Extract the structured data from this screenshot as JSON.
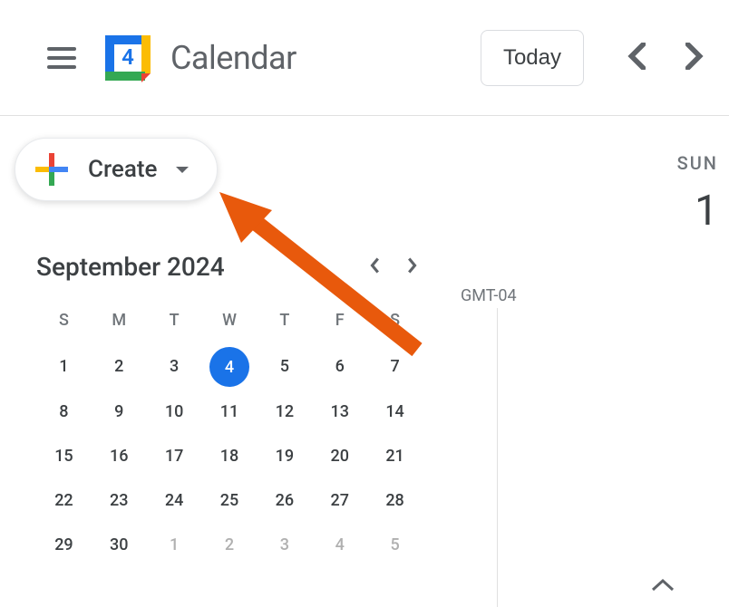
{
  "header": {
    "title": "Calendar",
    "today_label": "Today",
    "logo_day": "4"
  },
  "sidebar": {
    "create_label": "Create"
  },
  "mini_calendar": {
    "title": "September 2024",
    "dow": [
      "S",
      "M",
      "T",
      "W",
      "T",
      "F",
      "S"
    ],
    "weeks": [
      [
        {
          "n": "1"
        },
        {
          "n": "2"
        },
        {
          "n": "3"
        },
        {
          "n": "4",
          "today": true
        },
        {
          "n": "5"
        },
        {
          "n": "6"
        },
        {
          "n": "7"
        }
      ],
      [
        {
          "n": "8"
        },
        {
          "n": "9"
        },
        {
          "n": "10"
        },
        {
          "n": "11"
        },
        {
          "n": "12"
        },
        {
          "n": "13"
        },
        {
          "n": "14"
        }
      ],
      [
        {
          "n": "15"
        },
        {
          "n": "16"
        },
        {
          "n": "17"
        },
        {
          "n": "18"
        },
        {
          "n": "19"
        },
        {
          "n": "20"
        },
        {
          "n": "21"
        }
      ],
      [
        {
          "n": "22"
        },
        {
          "n": "23"
        },
        {
          "n": "24"
        },
        {
          "n": "25"
        },
        {
          "n": "26"
        },
        {
          "n": "27"
        },
        {
          "n": "28"
        }
      ],
      [
        {
          "n": "29"
        },
        {
          "n": "30"
        },
        {
          "n": "1",
          "muted": true
        },
        {
          "n": "2",
          "muted": true
        },
        {
          "n": "3",
          "muted": true
        },
        {
          "n": "4",
          "muted": true
        },
        {
          "n": "5",
          "muted": true
        }
      ]
    ]
  },
  "day_view": {
    "day_name": "SUN",
    "day_number": "1",
    "timezone": "GMT-04"
  }
}
